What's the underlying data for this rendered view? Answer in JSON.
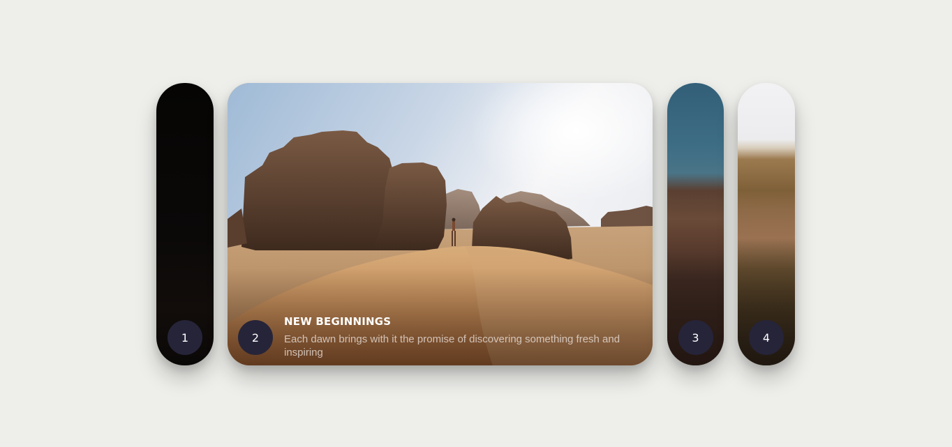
{
  "cards": [
    {
      "number": "1",
      "active": false
    },
    {
      "number": "2",
      "active": true,
      "title": "NEW BEGINNINGS",
      "description": "Each dawn brings with it the promise of discovering something fresh and inspiring"
    },
    {
      "number": "3",
      "active": false
    },
    {
      "number": "4",
      "active": false
    }
  ],
  "colors": {
    "page_background": "#eeefeb",
    "badge_background": "#262439",
    "badge_text": "#ffffff"
  }
}
